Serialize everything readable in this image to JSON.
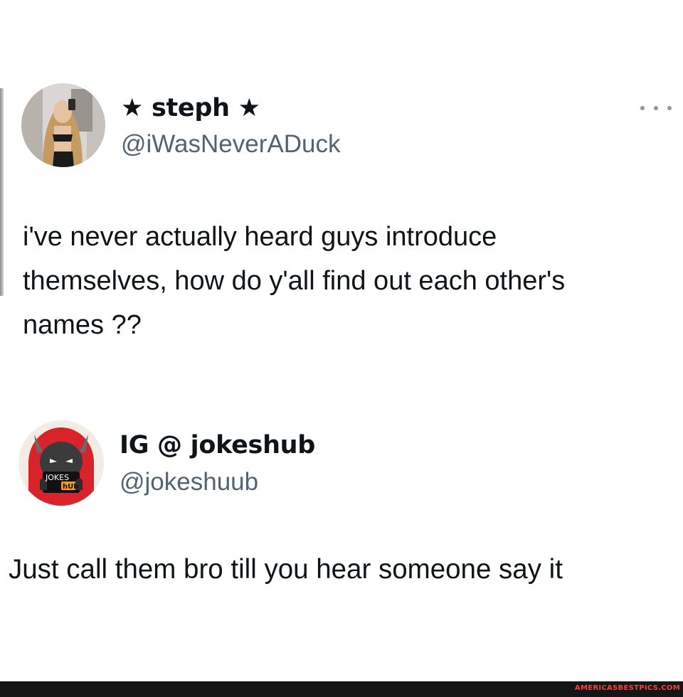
{
  "tweets": [
    {
      "display_name": "★ steph ★",
      "handle": "@iWasNeverADuck",
      "text": "i've never actually heard guys introduce\nthemselves, how do y'all find out each other's\nnames ??",
      "avatar_icon": "profile-photo"
    },
    {
      "display_name": "IG @ jokeshub",
      "handle": "@jokeshuub",
      "text": "Just call them bro till you hear someone say it",
      "avatar_icon": "devil-mascot",
      "avatar_sign": [
        "JOKES",
        "hUb"
      ]
    }
  ],
  "more_icon": "more-options-icon",
  "footer": {
    "watermark": "AMERICASBESTPICS.COM"
  },
  "colors": {
    "text": "#0f1419",
    "handle": "#536471",
    "more_dots": "#8b98a5",
    "watermark": "#ff3b3b",
    "footer_bg": "#151515"
  }
}
